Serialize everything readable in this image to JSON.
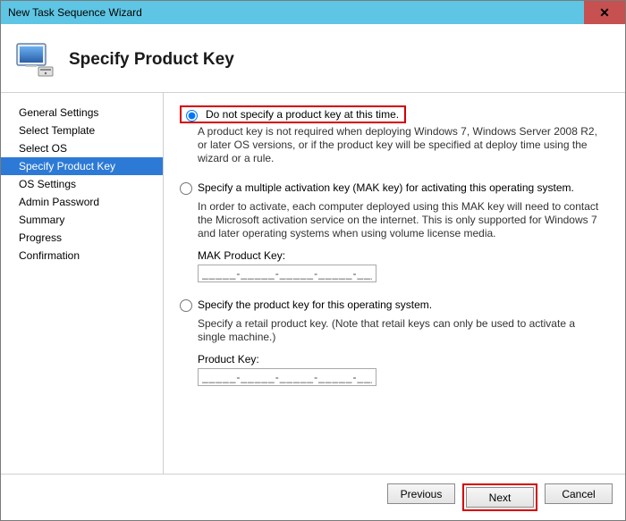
{
  "window": {
    "title": "New Task Sequence Wizard"
  },
  "header": {
    "title": "Specify Product Key"
  },
  "sidebar": {
    "items": [
      {
        "label": "General Settings",
        "selected": false
      },
      {
        "label": "Select Template",
        "selected": false
      },
      {
        "label": "Select OS",
        "selected": false
      },
      {
        "label": "Specify Product Key",
        "selected": true
      },
      {
        "label": "OS Settings",
        "selected": false
      },
      {
        "label": "Admin Password",
        "selected": false
      },
      {
        "label": "Summary",
        "selected": false
      },
      {
        "label": "Progress",
        "selected": false
      },
      {
        "label": "Confirmation",
        "selected": false
      }
    ]
  },
  "options": {
    "opt1": {
      "label": "Do not specify a product key at this time.",
      "desc": "A product key is not required when deploying Windows 7, Windows Server 2008 R2, or later OS versions, or if the product key will be specified at deploy time using the wizard or a rule."
    },
    "opt2": {
      "label": "Specify a multiple activation key (MAK key) for activating this operating system.",
      "desc": "In order to activate, each computer deployed using this MAK key will need to contact the Microsoft activation service on the internet.  This is only supported for Windows 7 and later operating systems when using volume license media.",
      "field_label": "MAK Product Key:",
      "field_value": "_____-_____-_____-_____-_____"
    },
    "opt3": {
      "label": "Specify the product key for this operating system.",
      "desc": "Specify a retail product key.  (Note that retail keys can only be used to activate a single machine.)",
      "field_label": "Product Key:",
      "field_value": "_____-_____-_____-_____-_____"
    },
    "selected": "opt1"
  },
  "footer": {
    "previous": "Previous",
    "next": "Next",
    "cancel": "Cancel"
  }
}
